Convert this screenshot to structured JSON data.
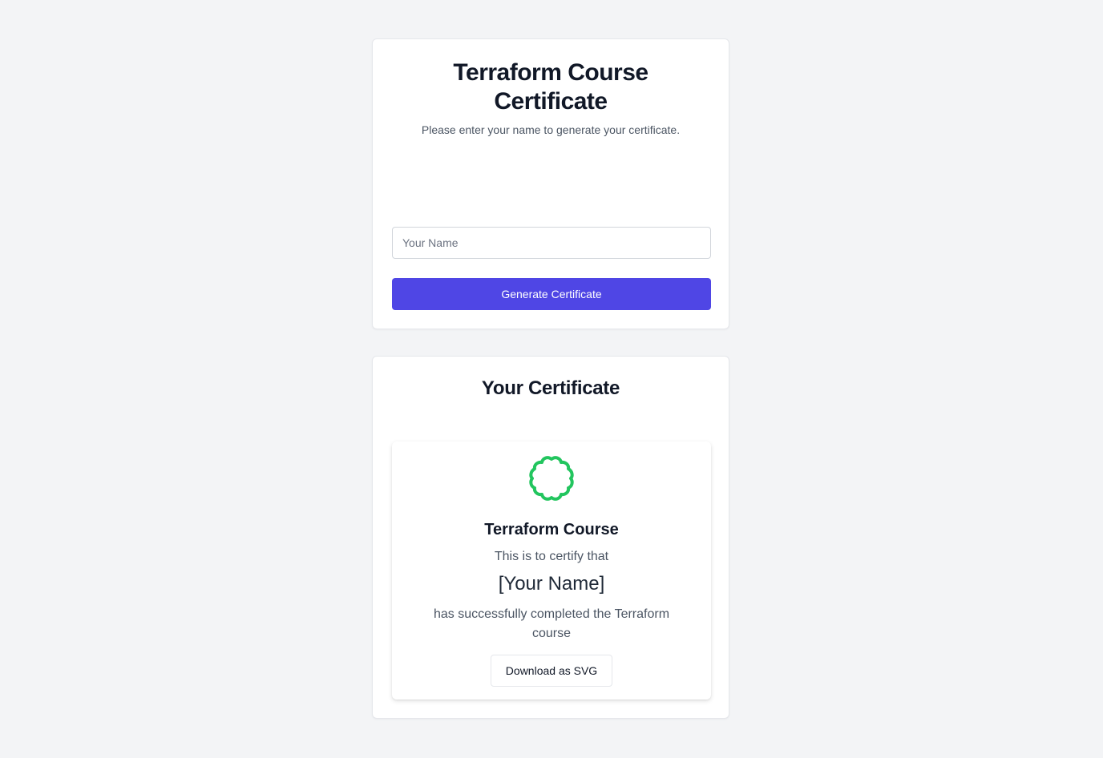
{
  "form_card": {
    "title": "Terraform Course Certificate",
    "subtitle": "Please enter your name to generate your certificate.",
    "name_input": {
      "value": "",
      "placeholder": "Your Name"
    },
    "generate_label": "Generate Certificate"
  },
  "certificate_card": {
    "heading": "Your Certificate",
    "preview": {
      "icon": "badge-icon",
      "course_name": "Terraform Course",
      "certify_text": "This is to certify that",
      "recipient_name": "[Your Name]",
      "completed_text": "has successfully completed the Terraform course",
      "download_label": "Download as SVG"
    }
  },
  "colors": {
    "background": "#f3f4f6",
    "primary": "#4f46e5",
    "badge": "#22c55e"
  }
}
